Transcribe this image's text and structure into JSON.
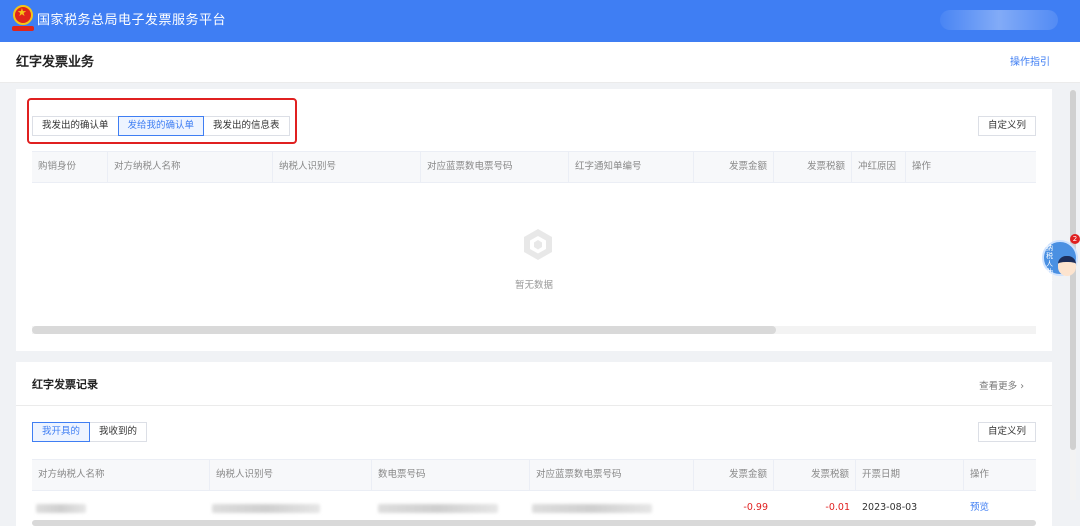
{
  "header": {
    "app_title": "国家税务总局电子发票服务平台"
  },
  "page": {
    "title": "红字发票业务",
    "guide_link": "操作指引"
  },
  "confirm_section": {
    "tabs": [
      {
        "label": "我发出的确认单",
        "active": false
      },
      {
        "label": "发给我的确认单",
        "active": true
      },
      {
        "label": "我发出的信息表",
        "active": false
      }
    ],
    "custom_columns": "自定义列",
    "columns": [
      "购销身份",
      "对方纳税人名称",
      "纳税人识别号",
      "对应蓝票数电票号码",
      "红字通知单编号",
      "发票金额",
      "发票税额",
      "冲红原因",
      "操作"
    ],
    "empty_text": "暂无数据"
  },
  "records_section": {
    "title": "红字发票记录",
    "view_more": "查看更多 ›",
    "tabs": [
      {
        "label": "我开具的",
        "active": true
      },
      {
        "label": "我收到的",
        "active": false
      }
    ],
    "custom_columns": "自定义列",
    "columns": [
      "对方纳税人名称",
      "纳税人识别号",
      "数电票号码",
      "对应蓝票数电票号码",
      "发票金额",
      "发票税额",
      "开票日期",
      "操作"
    ],
    "rows": [
      {
        "amount": "-0.99",
        "tax": "-0.01",
        "date": "2023-08-03",
        "action": "预览"
      }
    ]
  },
  "assistant": {
    "label": "纳税人助手",
    "badge": "2"
  },
  "colors": {
    "brand": "#3f7ef3",
    "highlight": "#e02020",
    "negative": "#e02020"
  }
}
